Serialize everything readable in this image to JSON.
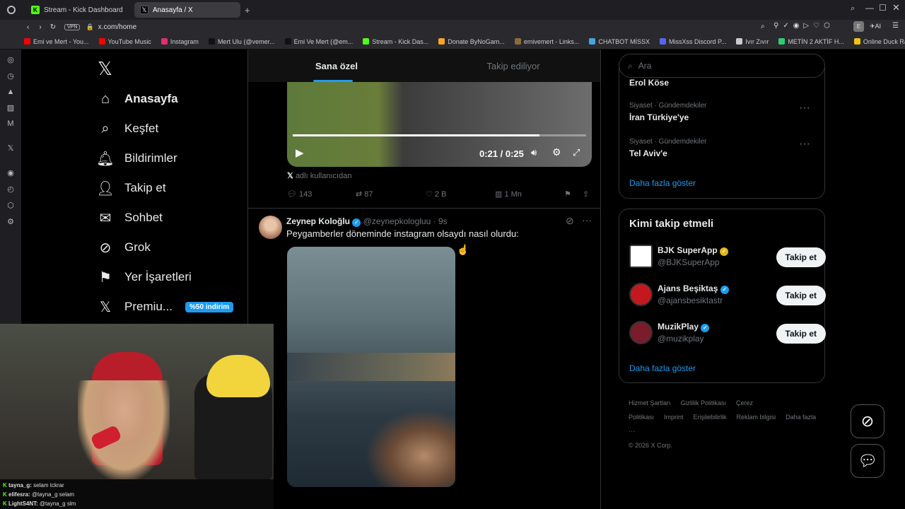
{
  "browser": {
    "tabs": [
      {
        "label": "Stream - Kick Dashboard"
      },
      {
        "label": "Anasayfa / X"
      }
    ],
    "url": "x.com/home",
    "vpn": "VPN"
  },
  "bookmarks": [
    {
      "label": "Emi ve Mert - You...",
      "color": "#ff0000"
    },
    {
      "label": "YouTube Music",
      "color": "#ff0000"
    },
    {
      "label": "Instagram",
      "color": "#e1306c"
    },
    {
      "label": "Mert Ulu (@vemer...",
      "color": "#111111"
    },
    {
      "label": "Emi Ve Mert (@em...",
      "color": "#111111"
    },
    {
      "label": "Stream - Kick Das...",
      "color": "#53fc18"
    },
    {
      "label": "Donate ByNoGam...",
      "color": "#f5a623"
    },
    {
      "label": "emivemert - Links...",
      "color": "#8a6d3b"
    },
    {
      "label": "CHATBOT MİSSX",
      "color": "#4aa3df"
    },
    {
      "label": "MissXss Discord P...",
      "color": "#5865f2"
    },
    {
      "label": "Ivır Zıvır",
      "color": "#cccccc"
    },
    {
      "label": "METİN 2 AKTİF H...",
      "color": "#2ecc71"
    },
    {
      "label": "Online Duck Race...",
      "color": "#f1c40f"
    }
  ],
  "nav": {
    "items": [
      {
        "label": "Anasayfa"
      },
      {
        "label": "Keşfet"
      },
      {
        "label": "Bildirimler"
      },
      {
        "label": "Takip et"
      },
      {
        "label": "Sohbet"
      },
      {
        "label": "Grok"
      },
      {
        "label": "Yer İşaretleri"
      },
      {
        "label": "Premiu..."
      }
    ],
    "premium_badge": "%50 indirim"
  },
  "feed": {
    "tabs": [
      "Sana özel",
      "Takip ediliyor"
    ],
    "video": {
      "time": "0:21 / 0:25",
      "progress": 0.84
    },
    "source_label": "adlı kullanıcıdan",
    "stats": {
      "replies": "143",
      "reposts": "87",
      "likes": "2 B",
      "views": "1 Mn"
    },
    "post": {
      "name": "Zeynep Koloğlu",
      "handle": "@zeynepkologluu",
      "time": "9s",
      "text": "Peygamberler döneminde instagram olsaydı nasıl olurdu:"
    }
  },
  "right": {
    "search_placeholder": "Ara",
    "trends": [
      {
        "name": "Erol Köse"
      },
      {
        "category": "Siyaset · Gündemdekiler",
        "name": "İran Türkiye'ye"
      },
      {
        "category": "Siyaset · Gündemdekiler",
        "name": "Tel Aviv'e"
      }
    ],
    "show_more": "Daha fazla göster",
    "who_to_follow": {
      "title": "Kimi takip etmeli",
      "accounts": [
        {
          "name": "BJK SuperApp",
          "handle": "@BJKSuperApp",
          "button": "Takip et"
        },
        {
          "name": "Ajans Beşiktaş",
          "handle": "@ajansbesiktastr",
          "button": "Takip et"
        },
        {
          "name": "MuzikPlay",
          "handle": "@muzikplay",
          "button": "Takip et"
        }
      ],
      "show_more": "Daha fazla göster"
    },
    "footer": {
      "links": [
        "Hizmet Şartları",
        "Gizlilik Politikası",
        "Çerez Politikası",
        "Imprint",
        "Erişilebilirlik",
        "Reklam bilgisi",
        "Daha fazla ···"
      ],
      "copyright": "© 2026 X Corp."
    }
  },
  "chat": {
    "lines": [
      {
        "user": "tayna_g:",
        "text": "selam tckrar"
      },
      {
        "user": "elifesra:",
        "text": "@tayna_g selam"
      },
      {
        "user": "LightS4NT:",
        "text": "@tayna_g slm"
      }
    ]
  }
}
